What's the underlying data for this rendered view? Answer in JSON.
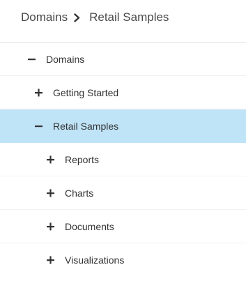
{
  "breadcrumb": {
    "items": [
      "Domains",
      "Retail Samples"
    ],
    "separator_icon": "chevron-right-icon"
  },
  "tree": {
    "root": {
      "label": "Domains",
      "expanded": true,
      "toggle_icon": "minus-icon"
    },
    "children": [
      {
        "label": "Getting Started",
        "expanded": false,
        "toggle_icon": "plus-icon"
      },
      {
        "label": "Retail Samples",
        "expanded": true,
        "selected": true,
        "toggle_icon": "minus-icon",
        "children": [
          {
            "label": "Reports",
            "toggle_icon": "plus-icon"
          },
          {
            "label": "Charts",
            "toggle_icon": "plus-icon"
          },
          {
            "label": "Documents",
            "toggle_icon": "plus-icon"
          },
          {
            "label": "Visualizations",
            "toggle_icon": "plus-icon"
          }
        ]
      }
    ]
  },
  "colors": {
    "selected_row": "#bfe3f7",
    "text": "#333333",
    "divider": "#e0e0e0"
  }
}
